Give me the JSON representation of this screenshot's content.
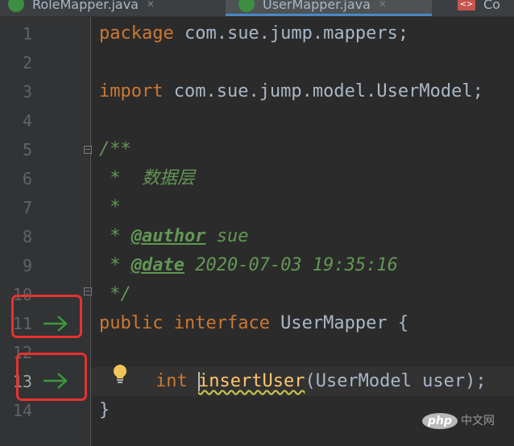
{
  "tabs": [
    {
      "label": "RoleMapper.java",
      "active": false
    },
    {
      "label": "UserMapper.java",
      "active": true
    },
    {
      "label": "Co",
      "active": false
    }
  ],
  "editor": {
    "line_numbers": [
      "1",
      "2",
      "3",
      "4",
      "5",
      "6",
      "7",
      "8",
      "9",
      "10",
      "11",
      "12",
      "13",
      "14"
    ],
    "current_line": "13",
    "lines": {
      "l1_kw": "package",
      "l1_rest": " com.sue.jump.mappers;",
      "l3_kw": "import",
      "l3_rest": " com.sue.jump.model.UserModel;",
      "l5": "/**",
      "l6": " *  数据层",
      "l7": " *",
      "l8_star": " * ",
      "l8_tag": "@author",
      "l8_val": " sue",
      "l9_star": " * ",
      "l9_tag": "@date",
      "l9_val": " 2020-07-03 19:35:16",
      "l10": " */",
      "l11_kw1": "public",
      "l11_kw2": " interface",
      "l11_rest": " UserMapper {",
      "l13_kw": "int",
      "l13_method": "insertUser",
      "l13_rest": "(UserModel user);",
      "l14": "}"
    }
  },
  "colors": {
    "keyword": "#cc7832",
    "doc": "#629755",
    "method": "#ffc66d",
    "highlight_box": "#e8322f",
    "gutter_arrow": "#3a9a3a"
  },
  "icons": [
    "java-class-icon",
    "fold-marker-icon",
    "implemented-arrow-icon",
    "lightbulb-icon"
  ],
  "watermark": {
    "badge": "php",
    "text": "中文网"
  }
}
